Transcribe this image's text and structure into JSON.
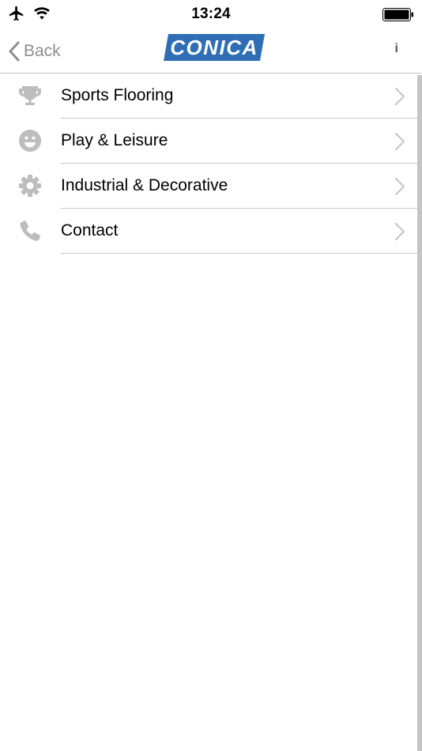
{
  "status_bar": {
    "time": "13:24",
    "icons": [
      "airplane-icon",
      "wifi-icon",
      "battery-icon"
    ]
  },
  "nav": {
    "back_label": "Back",
    "logo_text": "CONICA",
    "info_label": "i"
  },
  "colors": {
    "brand_blue": "#2f6eb5",
    "icon_gray": "#bdbdbd",
    "divider": "#c8c8cc",
    "back_gray": "#8e8e93"
  },
  "menu": {
    "items": [
      {
        "label": "Sports Flooring",
        "icon": "trophy-icon"
      },
      {
        "label": "Play & Leisure",
        "icon": "smiley-icon"
      },
      {
        "label": "Industrial & Decorative",
        "icon": "gear-icon"
      },
      {
        "label": "Contact",
        "icon": "phone-icon"
      }
    ]
  }
}
